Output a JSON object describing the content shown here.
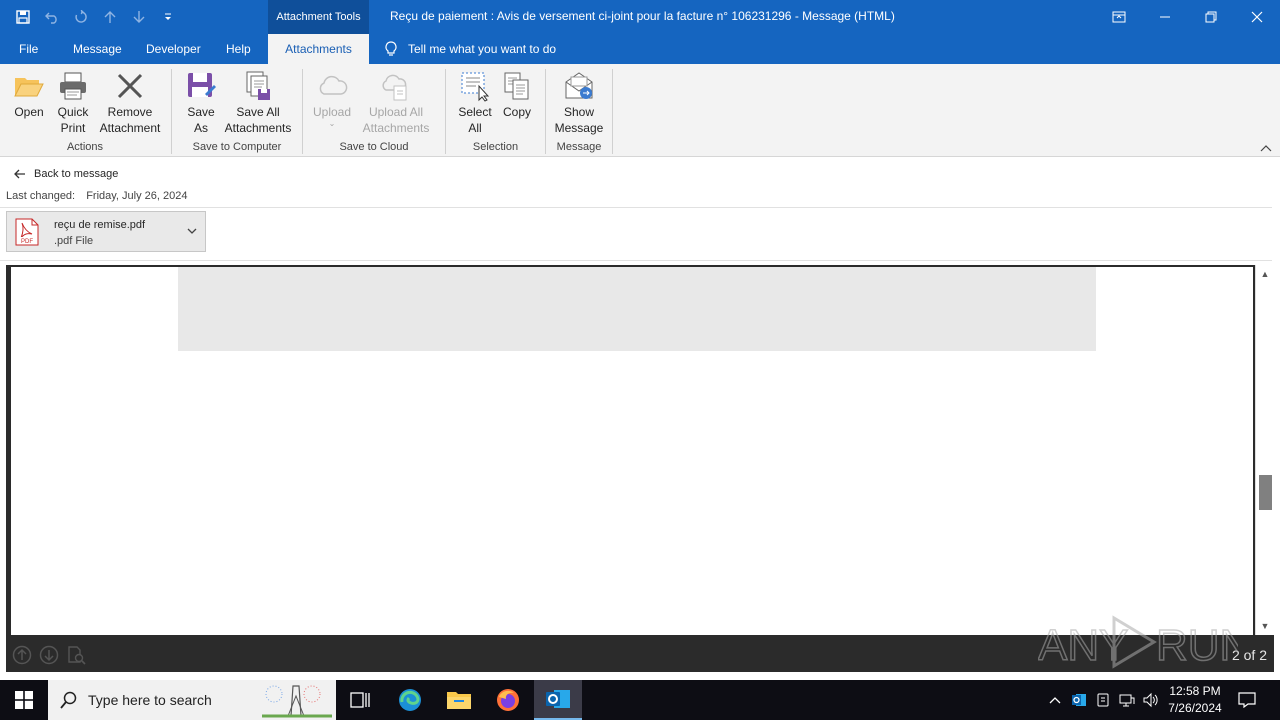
{
  "titlebar": {
    "context_tab": "Attachment Tools",
    "title": "Reçu de paiement : Avis de versement ci-joint pour la facture n° 106231296  -  Message (HTML)",
    "qat": [
      "save-icon",
      "undo-icon",
      "redo-icon",
      "up-arrow-icon",
      "down-arrow-icon",
      "customize-qat-icon"
    ],
    "window_controls": [
      "ribbon-display-options-icon",
      "minimize-icon",
      "restore-icon",
      "close-icon"
    ]
  },
  "tabs": {
    "file": "File",
    "message": "Message",
    "developer": "Developer",
    "help": "Help",
    "attachments": "Attachments",
    "tell_me": "Tell me what you want to do"
  },
  "ribbon": {
    "open": "Open",
    "quick_print_1": "Quick",
    "quick_print_2": "Print",
    "remove_1": "Remove",
    "remove_2": "Attachment",
    "save_as_1": "Save",
    "save_as_2": "As",
    "save_all_1": "Save All",
    "save_all_2": "Attachments",
    "upload": "Upload",
    "upload_all_1": "Upload All",
    "upload_all_2": "Attachments",
    "select_all_1": "Select",
    "select_all_2": "All",
    "copy": "Copy",
    "show_message_1": "Show",
    "show_message_2": "Message",
    "groups": {
      "actions": "Actions",
      "save_to_computer": "Save to Computer",
      "save_to_cloud": "Save to Cloud",
      "selection": "Selection",
      "message": "Message"
    }
  },
  "body": {
    "back": "Back to message",
    "last_changed_label": "Last changed:",
    "last_changed_value": "Friday, July 26, 2024",
    "attachment_name": "reçu de remise.pdf",
    "attachment_type": ".pdf File",
    "page_indicator": "2 of 2"
  },
  "watermark": "ANY RUN",
  "taskbar": {
    "search_placeholder": "Type here to search",
    "apps": [
      "task-view-icon",
      "edge-icon",
      "file-explorer-icon",
      "firefox-icon",
      "outlook-icon"
    ],
    "tray": [
      "chevron-up-icon",
      "outlook-tray-icon",
      "device-icon",
      "network-icon",
      "volume-icon"
    ],
    "time": "12:58 PM",
    "date": "7/26/2024"
  },
  "colors": {
    "accent": "#1565c0",
    "active_tab_text": "#1a5fb4",
    "viewer_bg": "#2b2b2b"
  }
}
